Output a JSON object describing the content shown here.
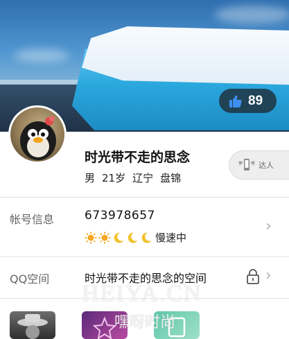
{
  "cover": {
    "like_icon": "thumbs-up-icon",
    "like_count": "89"
  },
  "profile": {
    "avatar_icon": "avatar-penguin",
    "nickname": "时光带不走的思念",
    "gender": "男",
    "age": "21岁",
    "location": [
      "辽宁",
      "盘锦"
    ],
    "badge_icon": "winged-phone-icon",
    "badge_label": "达人"
  },
  "account_row": {
    "label": "帐号信息",
    "qq_number": "673978657",
    "level_icons": [
      "sun-icon",
      "sun-icon",
      "moon-icon",
      "moon-icon",
      "moon-icon"
    ],
    "speed_text": "慢速中",
    "chevron_icon": "chevron-right-icon"
  },
  "space_row": {
    "label": "QQ空间",
    "space_name": "时光带不走的思念的空间",
    "lock_icon": "lock-icon",
    "chevron_icon": "chevron-right-icon"
  },
  "watermark": {
    "line1": "HEIYA.CN",
    "line2": "嘿呀时尚"
  },
  "colors": {
    "accent": "#4a90e2",
    "sun": "#f5a623",
    "moon": "#f2c230"
  }
}
